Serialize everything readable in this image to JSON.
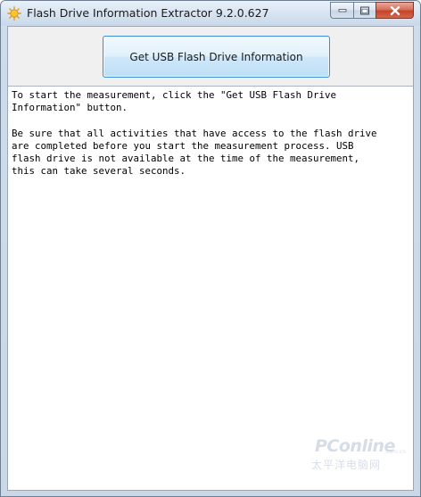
{
  "window": {
    "title": "Flash Drive Information Extractor 9.2.0.627",
    "icon": "sun-app-icon"
  },
  "caption_buttons": {
    "minimize": "minimize-icon",
    "maximize": "maximize-icon",
    "close": "close-icon"
  },
  "toolbar": {
    "get_info_label": "Get USB Flash Drive Information"
  },
  "output": {
    "paragraphs": [
      "To start the measurement, click the \"Get USB Flash Drive\nInformation\" button.",
      "Be sure that all activities that have access to the flash drive\nare completed before you start the measurement process. USB\nflash drive is not available at the time of the measurement,\nthis can take several seconds."
    ]
  },
  "watermark": {
    "brand": "PConline",
    "small": ".com.cn",
    "sub": "太平洋电脑网"
  },
  "colors": {
    "button_border": "#3c8ed6",
    "close_button": "#c4432a",
    "frame": "#c9d7e7"
  }
}
